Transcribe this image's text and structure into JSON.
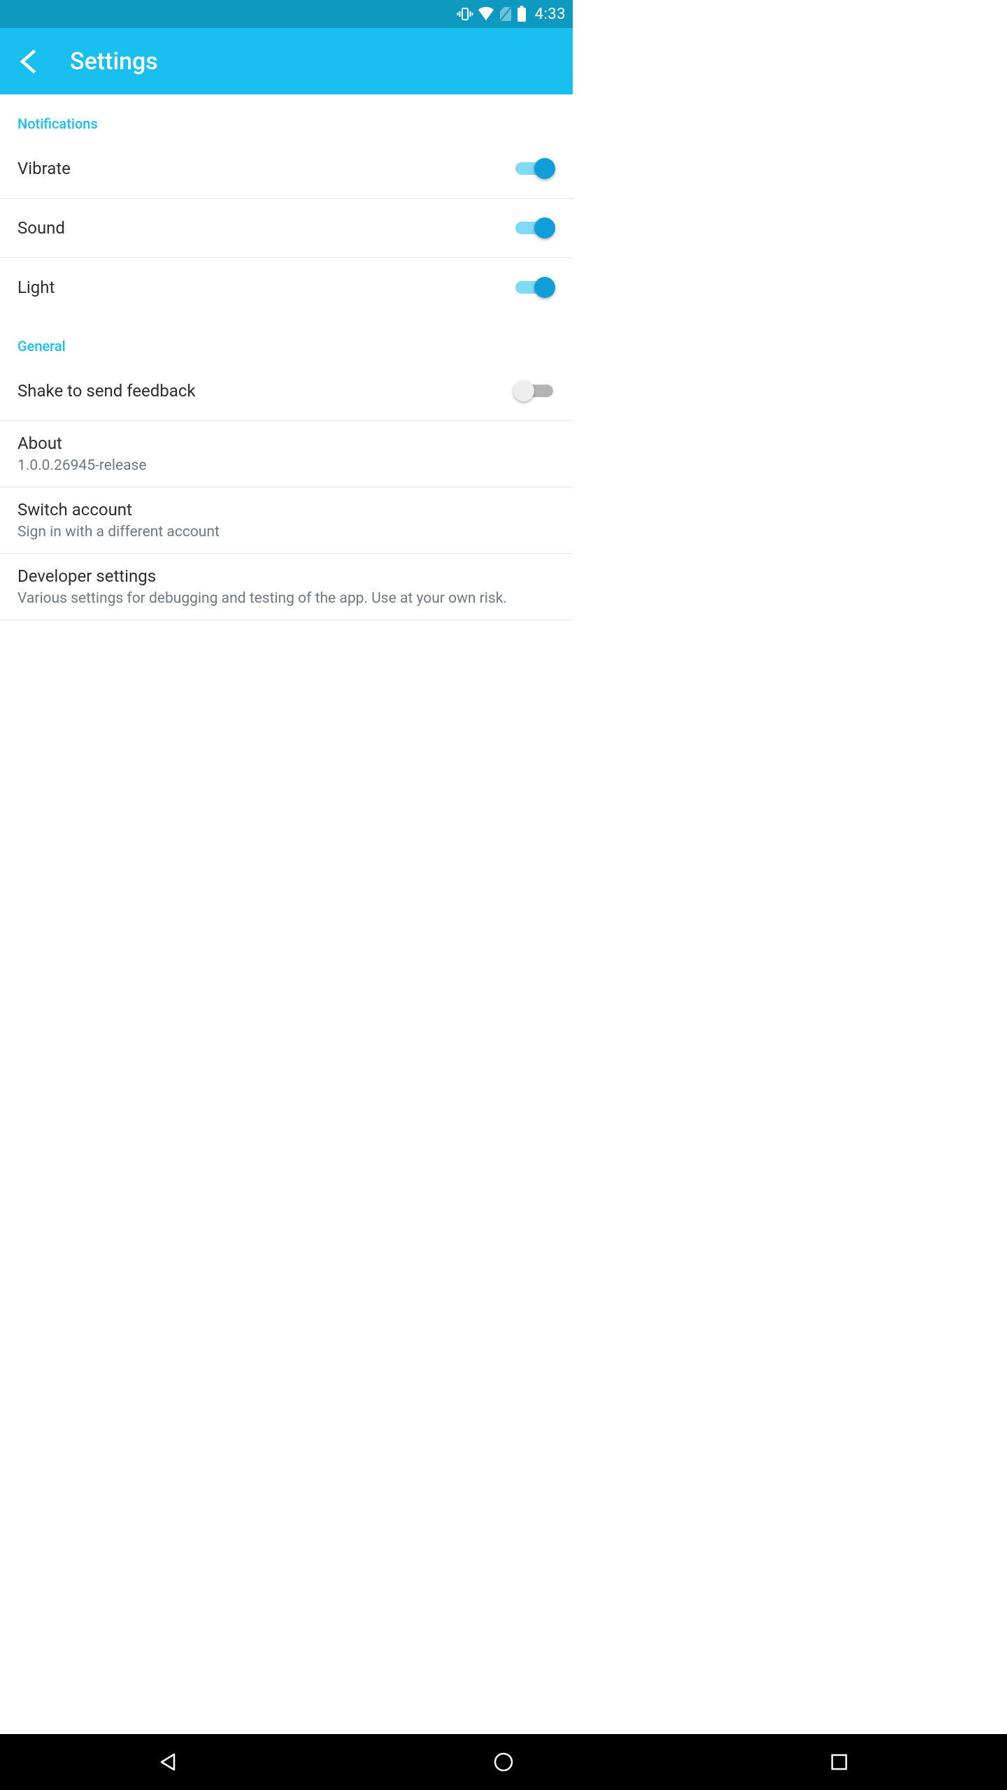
{
  "status": {
    "time": "4:33"
  },
  "header": {
    "title": "Settings"
  },
  "sections": {
    "notifications": {
      "header": "Notifications",
      "vibrate": "Vibrate",
      "sound": "Sound",
      "light": "Light"
    },
    "general": {
      "header": "General",
      "shake": "Shake to send feedback",
      "about_title": "About",
      "about_sub": "1.0.0.26945-release",
      "switch_title": "Switch account",
      "switch_sub": "Sign in with a different account",
      "dev_title": "Developer settings",
      "dev_sub": "Various settings for debugging and testing of the app. Use at your own risk."
    }
  }
}
